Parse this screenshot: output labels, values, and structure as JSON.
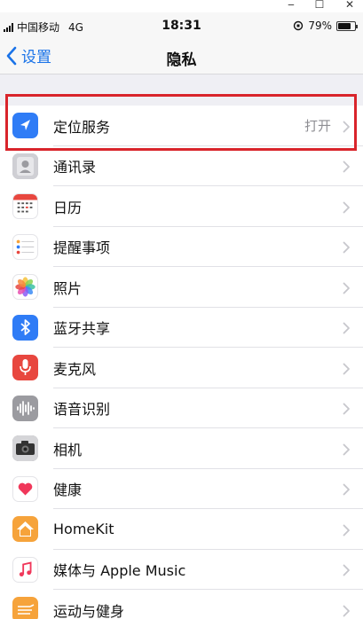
{
  "window": {
    "minimize": "‒",
    "maximize": "☐",
    "close": "✕"
  },
  "status_bar": {
    "carrier": "中国移动",
    "network": "4G",
    "time": "18:31",
    "battery_percent": "79%",
    "battery_level": 0.79
  },
  "nav": {
    "back_label": "设置",
    "title": "隐私"
  },
  "rows": [
    {
      "label": "定位服务",
      "value": "打开",
      "icon": "location-arrow-icon",
      "color": "#2f7cf6"
    },
    {
      "label": "通讯录",
      "value": "",
      "icon": "contacts-icon",
      "color": "#b9b9be"
    },
    {
      "label": "日历",
      "value": "",
      "icon": "calendar-icon",
      "color": "#ffffff"
    },
    {
      "label": "提醒事项",
      "value": "",
      "icon": "reminders-icon",
      "color": "#ffffff"
    },
    {
      "label": "照片",
      "value": "",
      "icon": "photos-icon",
      "color": "#ffffff"
    },
    {
      "label": "蓝牙共享",
      "value": "",
      "icon": "bluetooth-icon",
      "color": "#2f7cf6"
    },
    {
      "label": "麦克风",
      "value": "",
      "icon": "microphone-icon",
      "color": "#e8473f"
    },
    {
      "label": "语音识别",
      "value": "",
      "icon": "speech-recognition-icon",
      "color": "#9b9ba0"
    },
    {
      "label": "相机",
      "value": "",
      "icon": "camera-icon",
      "color": "#8e8e93"
    },
    {
      "label": "健康",
      "value": "",
      "icon": "health-icon",
      "color": "#ffffff"
    },
    {
      "label": "HomeKit",
      "value": "",
      "icon": "homekit-icon",
      "color": "#f6a33b"
    },
    {
      "label": "媒体与 Apple Music",
      "value": "",
      "icon": "music-icon",
      "color": "#ffffff"
    },
    {
      "label": "运动与健身",
      "value": "",
      "icon": "motion-icon",
      "color": "#f6a33b"
    }
  ]
}
